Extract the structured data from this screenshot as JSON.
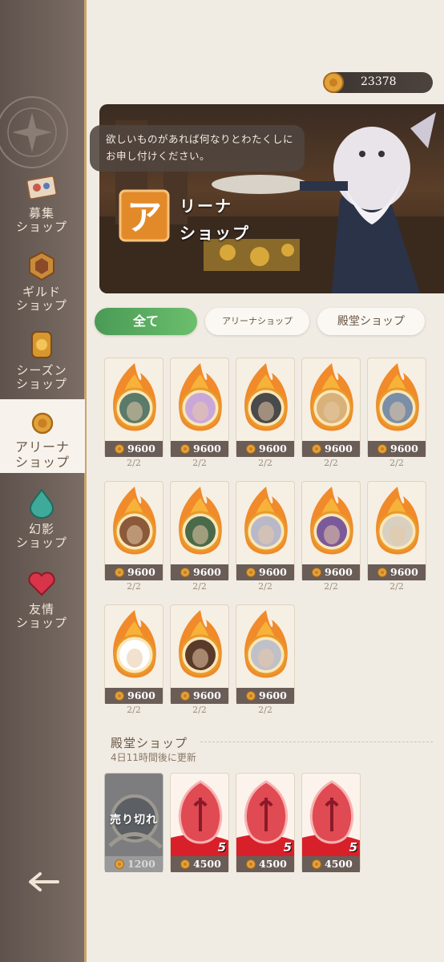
{
  "currency": {
    "icon": "coin-icon",
    "amount": "23378"
  },
  "banner": {
    "speech": "欲しいものがあれば何なりとわたくしにお申し付けください。",
    "title_line1": "リーナ",
    "title_line2": "ショップ",
    "title_icon_char": "ア"
  },
  "sidebar": {
    "items": [
      {
        "label": "募集\nショップ",
        "icon": "ticket-icon"
      },
      {
        "label": "ギルド\nショップ",
        "icon": "guild-badge-icon"
      },
      {
        "label": "シーズン\nショップ",
        "icon": "season-coin-icon"
      },
      {
        "label": "アリーナ\nショップ",
        "icon": "arena-coin-icon",
        "active": true
      },
      {
        "label": "幻影\nショップ",
        "icon": "phantom-drop-icon"
      },
      {
        "label": "友情\nショップ",
        "icon": "heart-icon"
      }
    ]
  },
  "tabs": [
    {
      "label": "全て",
      "active": true
    },
    {
      "label": "アリーナショップ"
    },
    {
      "label": "殿堂ショップ"
    }
  ],
  "arena_items": [
    {
      "price": "9600",
      "stock": "2/2",
      "hue": "#5a7a6a"
    },
    {
      "price": "9600",
      "stock": "2/2",
      "hue": "#c9a8d9"
    },
    {
      "price": "9600",
      "stock": "2/2",
      "hue": "#4a4a4a"
    },
    {
      "price": "9600",
      "stock": "2/2",
      "hue": "#d8b27a"
    },
    {
      "price": "9600",
      "stock": "2/2",
      "hue": "#7a8ea8"
    },
    {
      "price": "9600",
      "stock": "2/2",
      "hue": "#8a5a3a"
    },
    {
      "price": "9600",
      "stock": "2/2",
      "hue": "#4a6a4a"
    },
    {
      "price": "9600",
      "stock": "2/2",
      "hue": "#b8b8c8"
    },
    {
      "price": "9600",
      "stock": "2/2",
      "hue": "#7a5a9a"
    },
    {
      "price": "9600",
      "stock": "2/2",
      "hue": "#d8d0c0"
    },
    {
      "price": "9600",
      "stock": "2/2",
      "hue": "#ffffff"
    },
    {
      "price": "9600",
      "stock": "2/2",
      "hue": "#5a3a2a"
    },
    {
      "price": "9600",
      "stock": "2/2",
      "hue": "#c0c0c8"
    }
  ],
  "hall": {
    "title": "殿堂ショップ",
    "refresh": "4日11時間後に更新",
    "items": [
      {
        "price": "1200",
        "sold": true,
        "sold_label": "売り切れ"
      },
      {
        "price": "4500",
        "qty": "5"
      },
      {
        "price": "4500",
        "qty": "5"
      },
      {
        "price": "4500",
        "qty": "5"
      }
    ]
  },
  "colors": {
    "accent_green": "#5aa95e",
    "sidebar": "#6a5d57",
    "gold": "#e2a23a"
  }
}
